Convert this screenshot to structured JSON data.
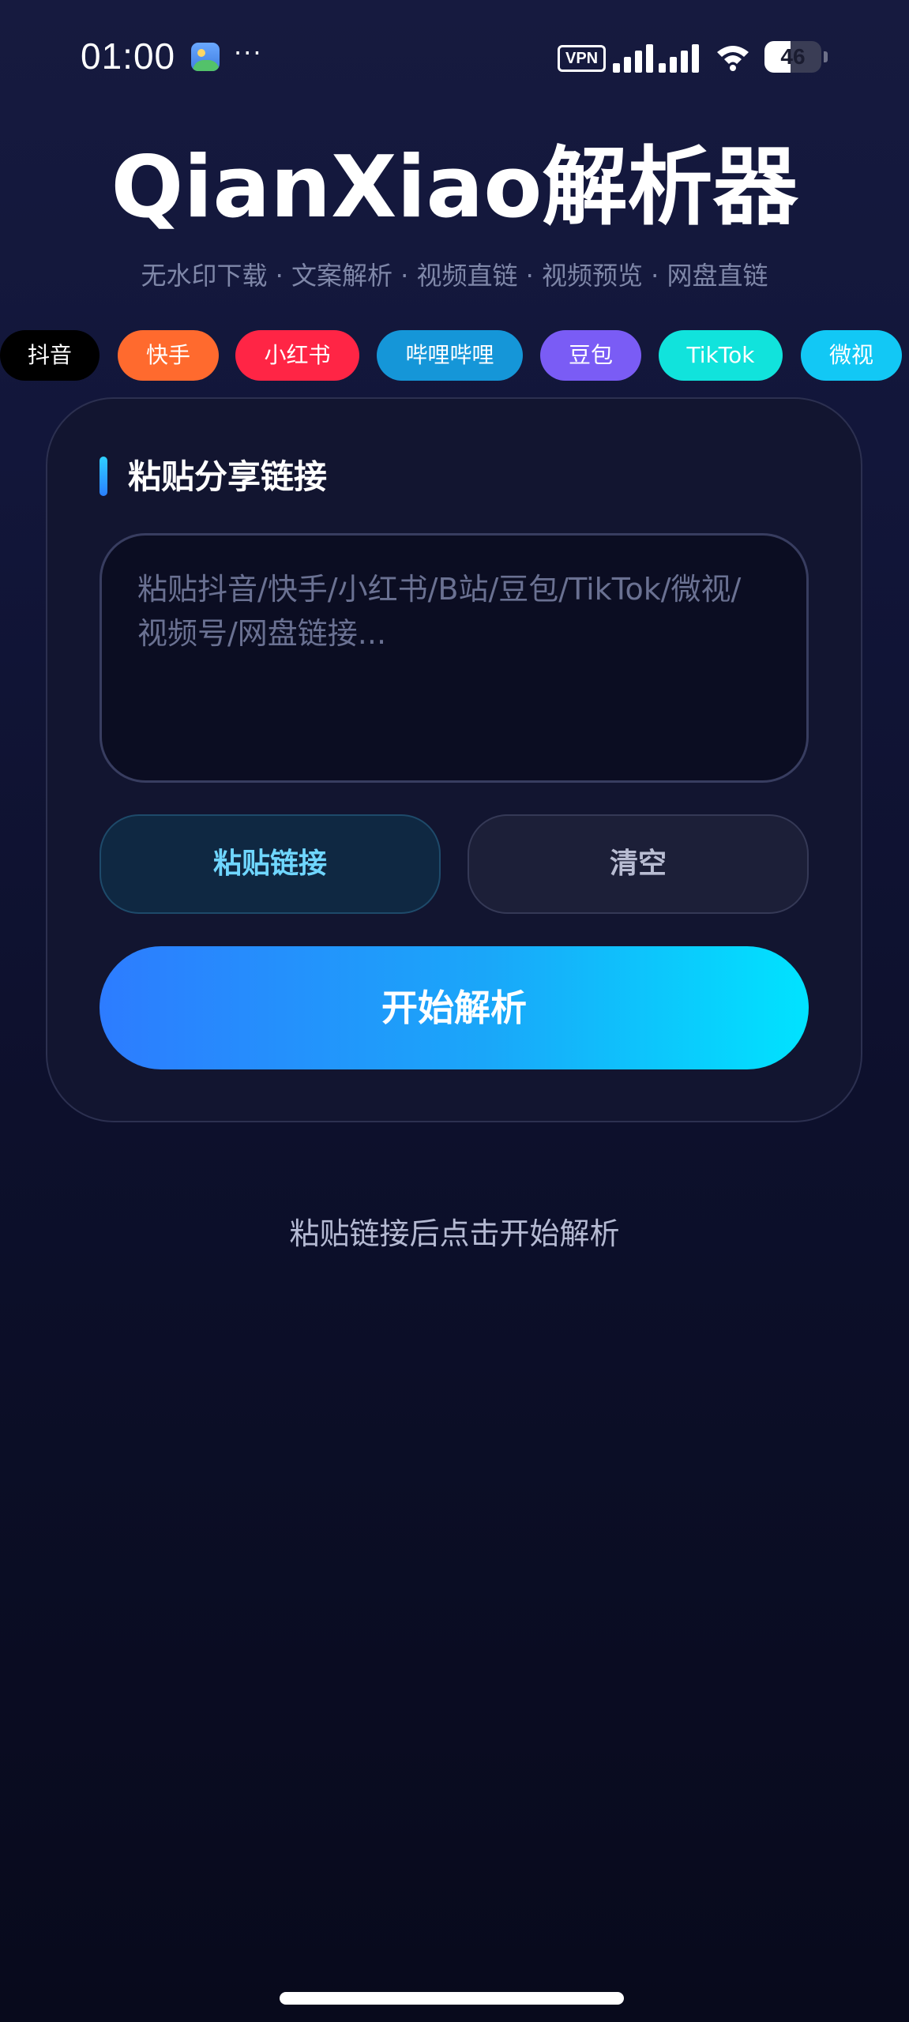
{
  "status_bar": {
    "time": "01:00",
    "more": "···",
    "vpn": "VPN",
    "battery": "46",
    "battery_level": 0.46,
    "gallery_icon": "gallery-icon",
    "signal_icon": "signal-bars-icon",
    "wifi_icon": "wifi-icon"
  },
  "header": {
    "title": "QianXiao解析器",
    "subtitle": "无水印下载 · 文案解析 · 视频直链 · 视频预览 · 网盘直链"
  },
  "platforms": [
    {
      "label": "抖音",
      "color": "#000000"
    },
    {
      "label": "快手",
      "color": "#ff6a2e"
    },
    {
      "label": "小红书",
      "color": "#ff2545"
    },
    {
      "label": "哔哩哔哩",
      "color": "#1596d8"
    },
    {
      "label": "豆包",
      "color": "#7a5cf5"
    },
    {
      "label": "TikTok",
      "color": "#11e3dc"
    },
    {
      "label": "微视",
      "color": "#12c8f5"
    }
  ],
  "card": {
    "section_title": "粘贴分享链接",
    "input_placeholder": "粘贴抖音/快手/小红书/B站/豆包/TikTok/微视/视频号/网盘链接...",
    "paste_button": "粘贴链接",
    "clear_button": "清空",
    "start_button": "开始解析"
  },
  "hint": "粘贴链接后点击开始解析",
  "colors": {
    "accent_start": "#2d7cff",
    "accent_end": "#00e3ff",
    "background": "#12163a"
  }
}
